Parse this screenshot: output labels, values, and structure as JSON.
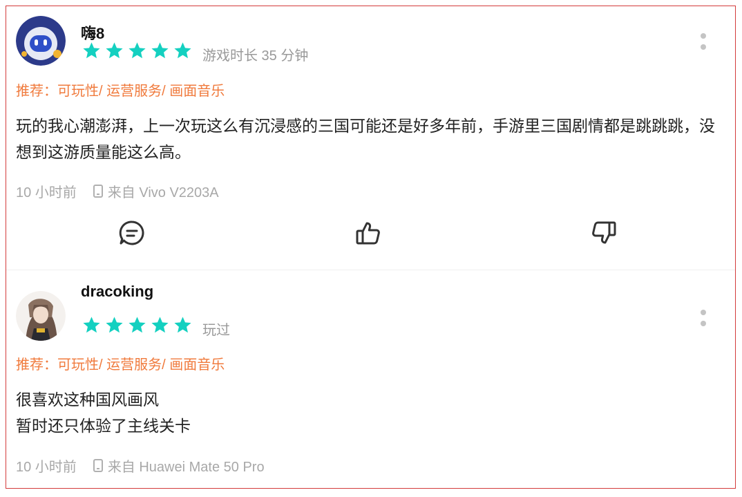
{
  "reviews": [
    {
      "username": "嗨8",
      "rating": 5,
      "meta_note": "游戏时长 35 分钟",
      "recommend": "推荐：可玩性/ 运营服务/ 画面音乐",
      "body": "玩的我心潮澎湃，上一次玩这么有沉浸感的三国可能还是好多年前，手游里三国剧情都是跳跳跳，没想到这游质量能这么高。",
      "time": "10 小时前",
      "device": "来自 Vivo V2203A"
    },
    {
      "username": "dracoking",
      "rating": 5,
      "meta_note": "玩过",
      "recommend": "推荐：可玩性/ 运营服务/ 画面音乐",
      "body": "很喜欢这种国风画风\n暂时还只体验了主线关卡",
      "time": "10 小时前",
      "device": "来自 Huawei Mate 50 Pro"
    }
  ],
  "colors": {
    "star": "#14d0c0",
    "recommend": "#f07a3c",
    "muted": "#a8a8a8",
    "frame_border": "#d33a3a"
  },
  "icons": {
    "comment": "comment-icon",
    "like": "thumbs-up-icon",
    "dislike": "thumbs-down-icon",
    "more": "more-vertical-icon",
    "device": "phone-icon"
  }
}
